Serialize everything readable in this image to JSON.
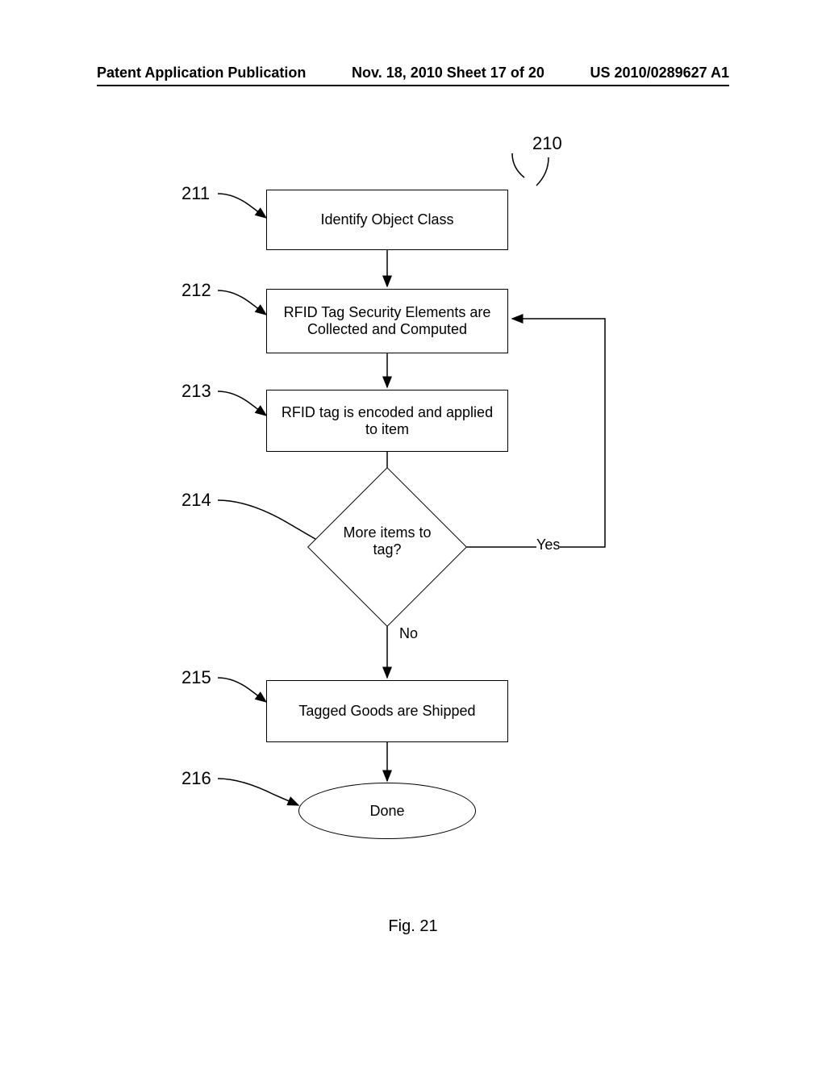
{
  "header": {
    "left": "Patent Application Publication",
    "middle": "Nov. 18, 2010  Sheet 17 of 20",
    "right": "US 2010/0289627 A1"
  },
  "flowchart": {
    "ref_overall": "210",
    "steps": {
      "211": {
        "label": "211",
        "text": "Identify Object Class"
      },
      "212": {
        "label": "212",
        "text": "RFID Tag Security Elements are Collected and Computed"
      },
      "213": {
        "label": "213",
        "text": "RFID tag is encoded and applied to item"
      },
      "214": {
        "label": "214",
        "text": "More items to tag?"
      },
      "215": {
        "label": "215",
        "text": "Tagged Goods are Shipped"
      },
      "216": {
        "label": "216",
        "text": "Done"
      }
    },
    "edge_labels": {
      "yes": "Yes",
      "no": "No"
    }
  },
  "caption": "Fig. 21"
}
